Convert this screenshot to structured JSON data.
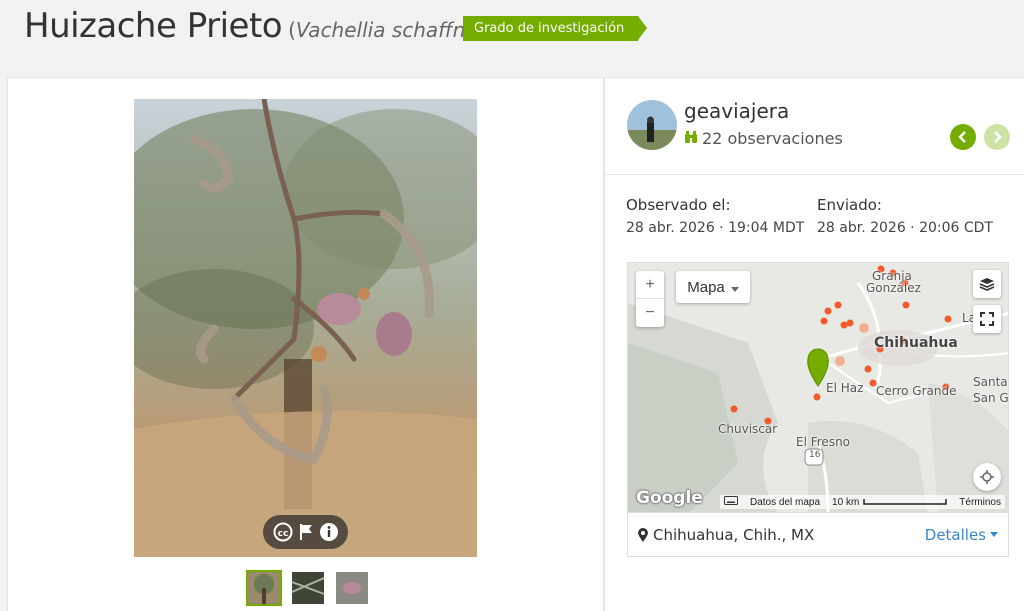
{
  "header": {
    "common_name": "Huizache Prieto",
    "scientific_name": "Vachellia schaffneri",
    "grade_badge": "Grado de investigación"
  },
  "observer": {
    "username": "geaviajera",
    "observations": "22 observaciones"
  },
  "dates": {
    "observed_label": "Observado el:",
    "observed_value": "28 abr. 2026 · 19:04 MDT",
    "submitted_label": "Enviado:",
    "submitted_value": "28 abr. 2026 · 20:06 CDT"
  },
  "map": {
    "type_label": "Mapa",
    "zoom_in": "+",
    "zoom_out": "−",
    "google": "Google",
    "map_data": "Datos del mapa",
    "scale": "10 km",
    "terms": "Términos",
    "places": {
      "chihuahua": "Chihuahua",
      "granja": "Granja",
      "gonzalez": "González",
      "el_haz": "El Haz",
      "cerro_grande": "Cerro Grande",
      "chuviscar": "Chuviscar",
      "el_fresno": "El Fresno",
      "santa": "Santa",
      "san_g": "San G",
      "la": "La",
      "hwy16a": "16",
      "hwy16b": "16"
    }
  },
  "location": {
    "text": "Chihuahua, Chih., MX",
    "details": "Detalles"
  },
  "colors": {
    "accent": "#74ac00",
    "link": "#3b86c8"
  }
}
